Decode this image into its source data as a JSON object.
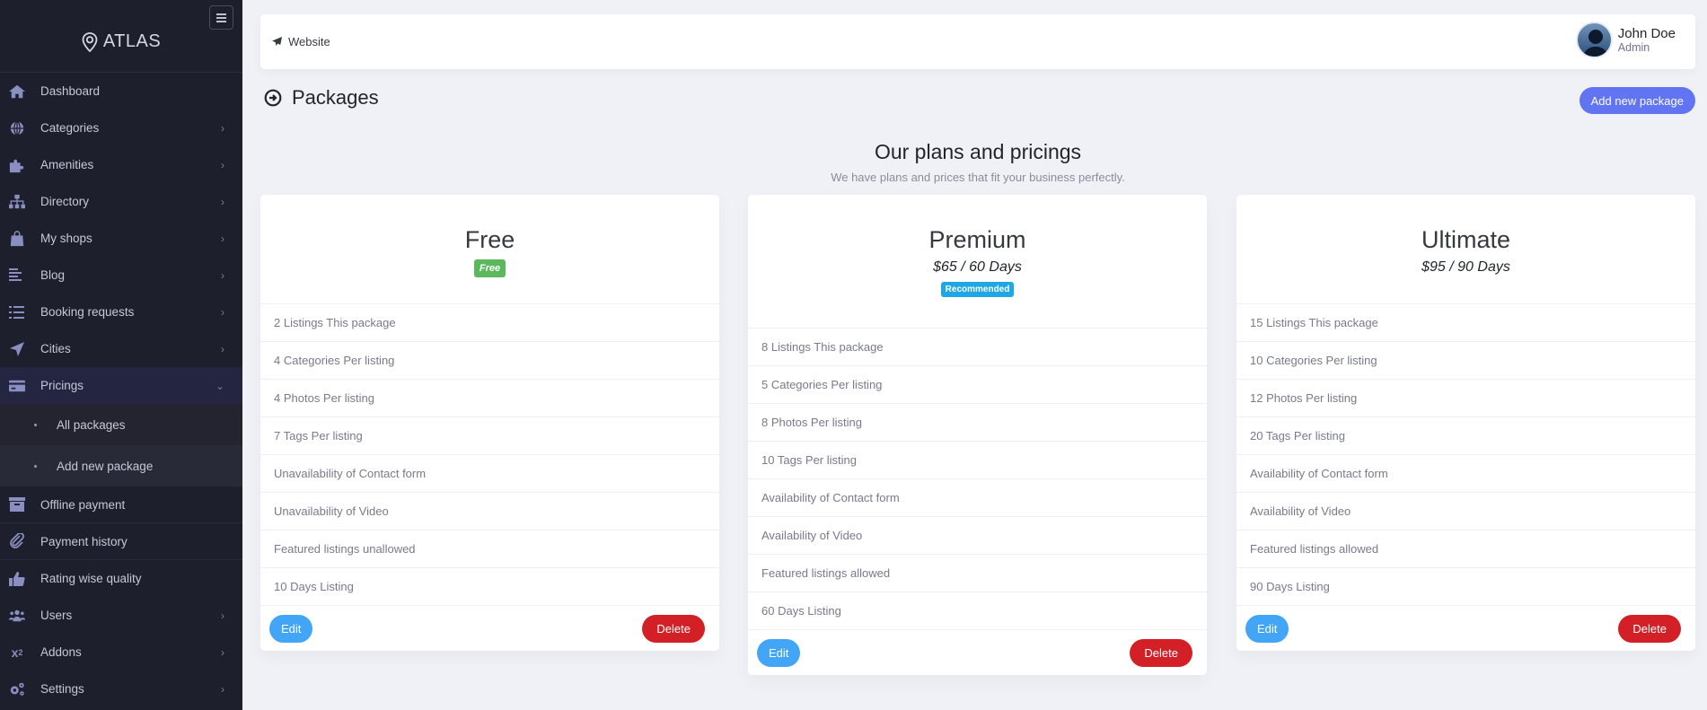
{
  "sidebar": {
    "brand": "ATLAS",
    "toggle_icon": "hamburger-icon",
    "items": [
      {
        "label": "Dashboard",
        "icon": "home-icon",
        "has_chevron": false
      },
      {
        "label": "Categories",
        "icon": "globe-icon",
        "has_chevron": true
      },
      {
        "label": "Amenities",
        "icon": "puzzle-icon",
        "has_chevron": true
      },
      {
        "label": "Directory",
        "icon": "sitemap-icon",
        "has_chevron": true
      },
      {
        "label": "My shops",
        "icon": "shopping-bag-icon",
        "has_chevron": true
      },
      {
        "label": "Blog",
        "icon": "align-left-icon",
        "has_chevron": true
      },
      {
        "label": "Booking requests",
        "icon": "tasks-icon",
        "has_chevron": true
      },
      {
        "label": "Cities",
        "icon": "location-arrow-icon",
        "has_chevron": true
      },
      {
        "label": "Pricings",
        "icon": "credit-card-icon",
        "has_chevron": true,
        "expanded": true,
        "children": [
          {
            "label": "All packages"
          },
          {
            "label": "Add new package"
          }
        ]
      },
      {
        "label": "Offline payment",
        "icon": "archive-icon",
        "has_chevron": false
      },
      {
        "label": "Payment history",
        "icon": "paperclip-icon",
        "has_chevron": false
      },
      {
        "label": "Rating wise quality",
        "icon": "thumbs-up-icon",
        "has_chevron": false
      },
      {
        "label": "Users",
        "icon": "users-icon",
        "has_chevron": true
      },
      {
        "label": "Addons",
        "icon": "superscript-icon",
        "has_chevron": true
      },
      {
        "label": "Settings",
        "icon": "cogs-icon",
        "has_chevron": true
      }
    ]
  },
  "topbar": {
    "website_label": "Website",
    "user_name": "John Doe",
    "user_role": "Admin"
  },
  "page": {
    "title": "Packages",
    "add_button": "Add new package",
    "heading": "Our plans and pricings",
    "subheading": "We have plans and prices that fit your business perfectly."
  },
  "packages": [
    {
      "name": "Free",
      "price": "",
      "badge": "Free",
      "features": [
        "2 Listings This package",
        "4 Categories Per listing",
        "4 Photos Per listing",
        "7 Tags Per listing",
        "Unavailability of Contact form",
        "Unavailability of Video",
        "Featured listings unallowed",
        "10 Days Listing"
      ],
      "edit_label": "Edit",
      "delete_label": "Delete"
    },
    {
      "name": "Premium",
      "price": "$65 / 60 Days",
      "badge": "Recommended",
      "features": [
        "8 Listings This package",
        "5 Categories Per listing",
        "8 Photos Per listing",
        "10 Tags Per listing",
        "Availability of Contact form",
        "Availability of Video",
        "Featured listings allowed",
        "60 Days Listing"
      ],
      "edit_label": "Edit",
      "delete_label": "Delete"
    },
    {
      "name": "Ultimate",
      "price": "$95 / 90 Days",
      "badge": "",
      "features": [
        "15 Listings This package",
        "10 Categories Per listing",
        "12 Photos Per listing",
        "20 Tags Per listing",
        "Availability of Contact form",
        "Availability of Video",
        "Featured listings allowed",
        "90 Days Listing"
      ],
      "edit_label": "Edit",
      "delete_label": "Delete"
    }
  ],
  "colors": {
    "sidebar_bg": "#1e1f2c",
    "accent": "#6174f2",
    "edit": "#42a5f5",
    "delete": "#d32027",
    "free_badge": "#5cb85c",
    "recommended_badge": "#1ea7e3"
  }
}
